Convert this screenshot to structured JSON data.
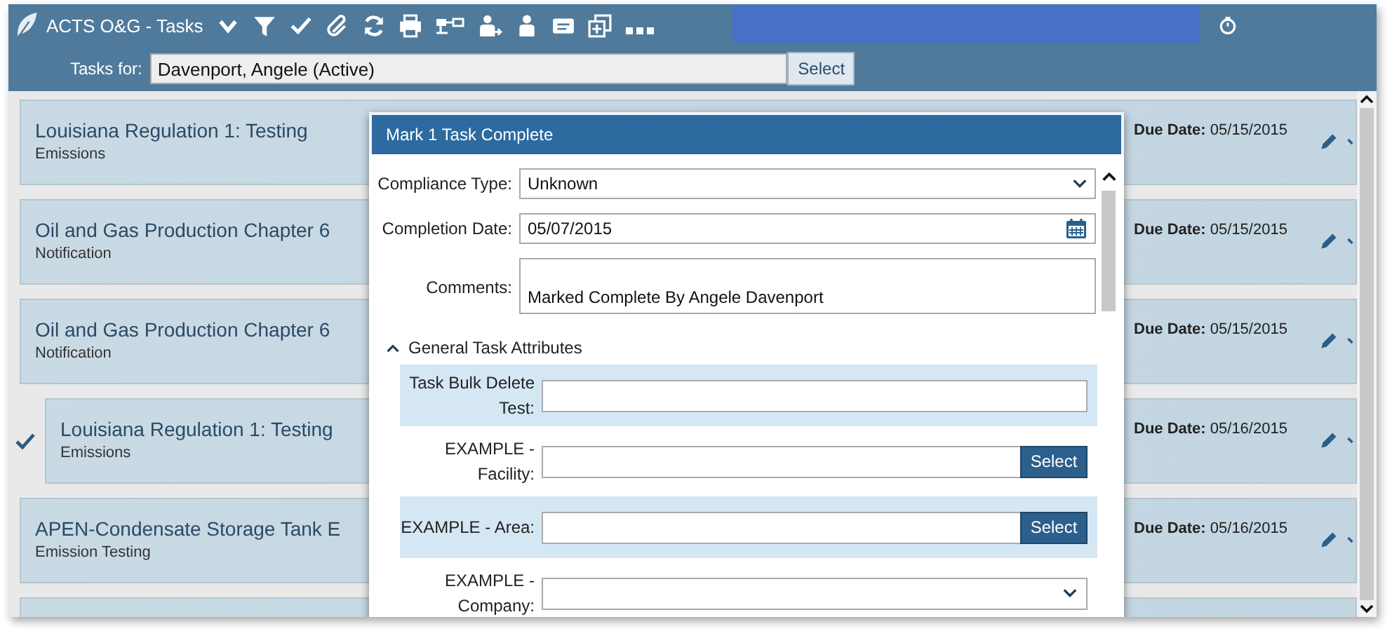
{
  "app": {
    "title": "ACTS O&G - Tasks"
  },
  "tasks_for": {
    "label": "Tasks for:",
    "value": "Davenport, Angele (Active)",
    "button": "Select"
  },
  "tasks": [
    {
      "title": "Louisiana Regulation 1: Testing",
      "category": "Emissions",
      "due_label": "Due Date:",
      "due_date": "05/15/2015",
      "checked": false
    },
    {
      "title": "Oil and Gas Production Chapter 6",
      "category": "Notification",
      "due_label": "Due Date:",
      "due_date": "05/15/2015",
      "checked": false
    },
    {
      "title": "Oil and Gas Production Chapter 6",
      "category": "Notification",
      "due_label": "Due Date:",
      "due_date": "05/15/2015",
      "checked": false
    },
    {
      "title": "Louisiana Regulation 1: Testing",
      "category": "Emissions",
      "due_label": "Due Date:",
      "due_date": "05/16/2015",
      "checked": true
    },
    {
      "title": "APEN-Condensate Storage Tank E",
      "category": "Emission Testing",
      "due_label": "Due Date:",
      "due_date": "05/16/2015",
      "checked": false
    }
  ],
  "modal": {
    "title": "Mark 1 Task Complete",
    "fields": [
      {
        "kind": "select",
        "label": "Compliance Type:",
        "value": "Unknown"
      },
      {
        "kind": "date",
        "label": "Completion Date:",
        "value": "05/07/2015"
      },
      {
        "kind": "textarea",
        "label": "Comments:",
        "value": "Marked Complete By Angele Davenport"
      }
    ],
    "section": {
      "title": "General Task Attributes",
      "expanded": true,
      "fields": [
        {
          "kind": "text",
          "label": "Task Bulk Delete Test:"
        },
        {
          "kind": "lookup",
          "label": "EXAMPLE - Facility:",
          "button": "Select"
        },
        {
          "kind": "lookup",
          "label": "EXAMPLE - Area:",
          "button": "Select"
        },
        {
          "kind": "select",
          "label": "EXAMPLE - Company:"
        }
      ]
    }
  }
}
